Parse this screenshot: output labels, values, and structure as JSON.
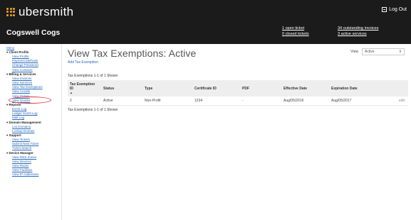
{
  "header": {
    "logo_text": "ubersmith",
    "logout_label": "Log Out",
    "company_name": "Cogswell Cogs",
    "tickets": [
      "1 open ticket",
      "0 closed tickets"
    ],
    "billing": [
      "34 outstanding invoices",
      "3 active services"
    ]
  },
  "sidebar": {
    "menu_title": "Menu",
    "sections": [
      {
        "title": "Client Profile",
        "links": [
          "View Profile",
          "Payment Methods",
          "Change Password",
          "View Contacts"
        ]
      },
      {
        "title": "Billing & Services",
        "links": [
          "View Invoices",
          "View Services",
          "View Tax Exemptions",
          "View Credits",
          "View Orders",
          "View Quotes"
        ]
      },
      {
        "title": "Reports",
        "links": [
          "Event Log",
          "Ledger Event Log",
          "Mail Log"
        ]
      },
      {
        "title": "Domain Management",
        "links": [
          "List Domains",
          "Lookup Domain"
        ]
      },
      {
        "title": "Support",
        "links": [
          "View Tickets",
          "Submit New Ticket",
          "Ticket Search"
        ]
      },
      {
        "title": "Device Manager",
        "links": [
          "View DNS Zones",
          "View Devices",
          "View Racks",
          "View Facilities",
          "View IP Addresses"
        ]
      }
    ],
    "active_link": "View Tax Exemptions"
  },
  "main": {
    "title": "View Tax Exemptions: Active",
    "add_link": "Add Tax Exemption",
    "view_label": "View",
    "view_value": "Active",
    "summary": "Tax Exemptions 1-1 of 1 Shown",
    "columns": [
      "Tax Exemption ID",
      "Status",
      "Type",
      "Certificate ID",
      "PDF",
      "Effective Date",
      "Expiration Date",
      ""
    ],
    "rows": [
      [
        "2",
        "Active",
        "Non-Profit",
        "1234",
        "-",
        "Aug/05/2016",
        "Aug/05/2017",
        "edit"
      ]
    ]
  },
  "colors": {
    "header_bg": "#1b1b1b",
    "logo_accent": "#f5a623",
    "link": "#2a6ab8",
    "highlight_circle": "#dd3333"
  }
}
